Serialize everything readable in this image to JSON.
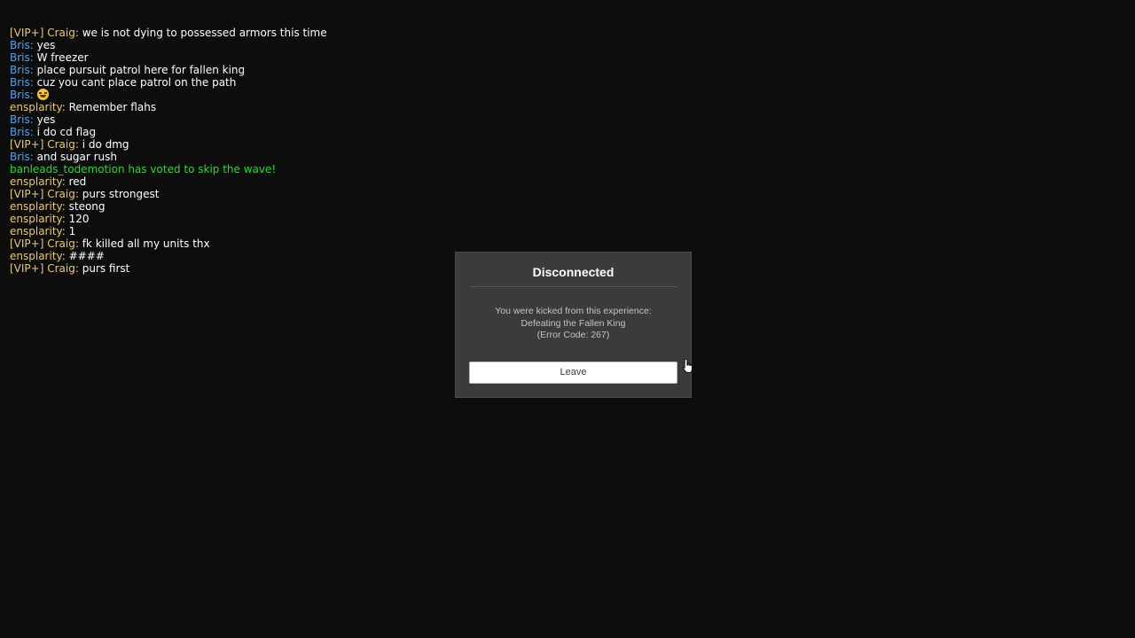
{
  "chat": {
    "lines": [
      {
        "name": "[VIP+] Craig:",
        "name_color": "#e7c87a",
        "message": " we is not dying to possessed armors this time"
      },
      {
        "name": "Bris:",
        "name_color": "#5aa0e6",
        "message": " yes"
      },
      {
        "name": "Bris:",
        "name_color": "#5aa0e6",
        "message": " W freezer"
      },
      {
        "name": "Bris:",
        "name_color": "#5aa0e6",
        "message": " place pursuit patrol here for fallen king"
      },
      {
        "name": "Bris:",
        "name_color": "#5aa0e6",
        "message": " cuz you cant place patrol on the path"
      },
      {
        "name": "Bris:",
        "name_color": "#5aa0e6",
        "message": " ",
        "emoji": "grinning-sweat-emoji"
      },
      {
        "name": "ensplarity:",
        "name_color": "#e7c87a",
        "message": " Remember flahs"
      },
      {
        "name": "Bris:",
        "name_color": "#5aa0e6",
        "message": " yes"
      },
      {
        "name": "Bris:",
        "name_color": "#5aa0e6",
        "message": " i do cd flag"
      },
      {
        "name": "[VIP+] Craig:",
        "name_color": "#e7c87a",
        "message": " i do dmg"
      },
      {
        "name": "Bris:",
        "name_color": "#5aa0e6",
        "message": " and sugar rush"
      },
      {
        "system": "banleads_todemotion has voted to skip the wave!",
        "color": "#36d13a"
      },
      {
        "name": "ensplarity:",
        "name_color": "#e7c87a",
        "message": " red"
      },
      {
        "name": "[VIP+] Craig:",
        "name_color": "#e7c87a",
        "message": " purs strongest"
      },
      {
        "name": "ensplarity:",
        "name_color": "#e7c87a",
        "message": " steong"
      },
      {
        "name": "ensplarity:",
        "name_color": "#e7c87a",
        "message": " 120"
      },
      {
        "name": "ensplarity:",
        "name_color": "#e7c87a",
        "message": " 1"
      },
      {
        "name": "[VIP+] Craig:",
        "name_color": "#e7c87a",
        "message": " fk killed all my units thx"
      },
      {
        "name": "ensplarity:",
        "name_color": "#e7c87a",
        "message": " ####"
      },
      {
        "name": "[VIP+] Craig:",
        "name_color": "#e7c87a",
        "message": " purs first"
      }
    ]
  },
  "dialog": {
    "title": "Disconnected",
    "message_line1": "You were kicked from this experience:",
    "message_line2": "Defeating the Fallen King",
    "message_line3": "(Error Code: 267)",
    "leave_label": "Leave"
  },
  "cursor": {
    "icon": "hand-pointer-icon"
  }
}
